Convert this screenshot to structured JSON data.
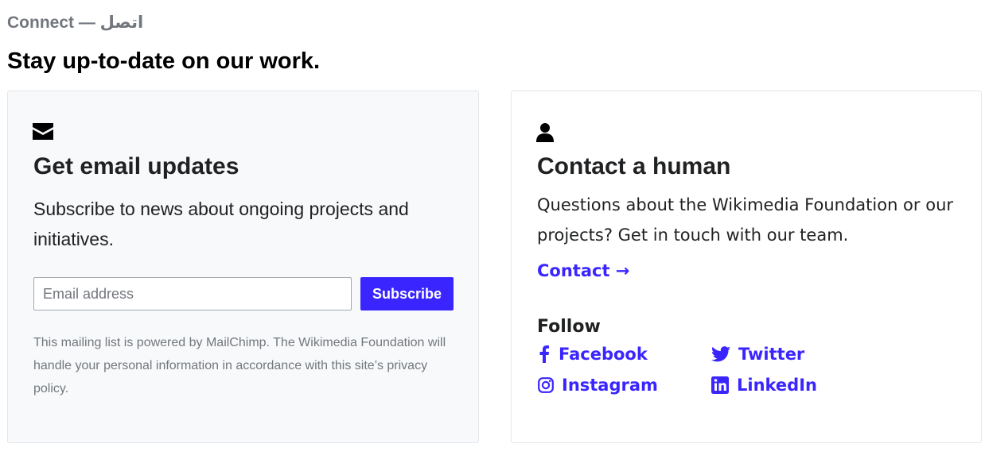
{
  "section": {
    "eyebrow": "Connect — اتصل",
    "headline": "Stay up-to-date on our work."
  },
  "email_card": {
    "icon": "envelope-icon",
    "title": "Get email updates",
    "description": "Subscribe to news about ongoing projects and initiatives.",
    "input_placeholder": "Email address",
    "input_value": "",
    "subscribe_label": "Subscribe",
    "fineprint": "This mailing list is powered by MailChimp. The Wikimedia Foundation will handle your personal information in accordance with this site’s privacy policy."
  },
  "contact_card": {
    "icon": "person-icon",
    "title": "Contact a human",
    "description": "Questions about the Wikimedia Foundation or our projects? Get in touch with our team.",
    "contact_label": "Contact →",
    "follow_heading": "Follow",
    "social": [
      {
        "label": "Facebook",
        "icon": "facebook-icon"
      },
      {
        "label": "Twitter",
        "icon": "twitter-icon"
      },
      {
        "label": "Instagram",
        "icon": "instagram-icon"
      },
      {
        "label": "LinkedIn",
        "icon": "linkedin-icon"
      }
    ]
  },
  "colors": {
    "accent": "#3a25ff",
    "muted_text": "#72777d",
    "card_background": "#f8f9fa",
    "card_border": "#e4e6e9"
  }
}
